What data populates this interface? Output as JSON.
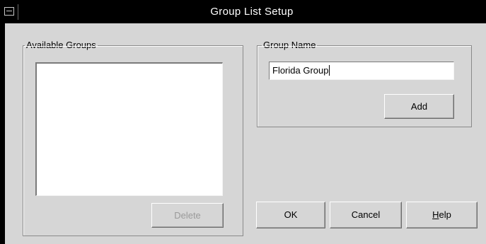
{
  "window": {
    "title": "Group List Setup"
  },
  "available_groups": {
    "legend": "Available Groups",
    "items": [],
    "delete_label": "Delete"
  },
  "group_name": {
    "legend": "Group Name",
    "value": "Florida Group",
    "add_label": "Add"
  },
  "footer": {
    "ok_label": "OK",
    "cancel_label": "Cancel",
    "help_mnemonic": "H",
    "help_rest": "elp"
  }
}
